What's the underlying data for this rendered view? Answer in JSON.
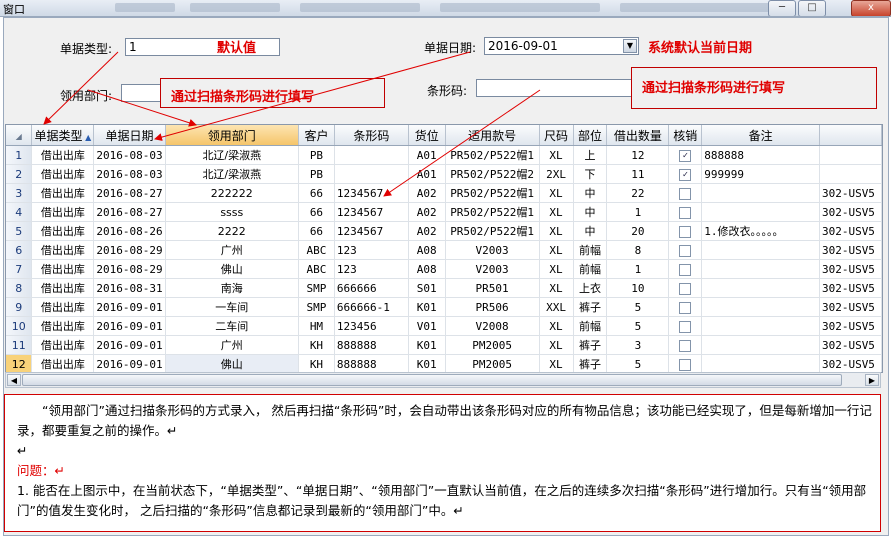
{
  "window": {
    "title": "窗口",
    "close_label": "x"
  },
  "form": {
    "doc_type_label": "单据类型:",
    "doc_type_value": "1",
    "doc_type_note": "默认值",
    "doc_date_label": "单据日期:",
    "doc_date_value": "2016-09-01",
    "doc_date_note": "系统默认当前日期",
    "dept_label": "领用部门:",
    "dept_value": "",
    "dept_note": "通过扫描条形码进行填写",
    "barcode_label": "条形码:",
    "barcode_value": "",
    "barcode_note": "通过扫描条形码进行填写"
  },
  "grid": {
    "columns": [
      "单据类型",
      "单据日期",
      "领用部门",
      "客户",
      "条形码",
      "货位",
      "适用款号",
      "尺码",
      "部位",
      "借出数量",
      "核销",
      "备注",
      ""
    ],
    "rows": [
      {
        "n": "1",
        "type": "借出出库",
        "date": "2016-08-03",
        "dept": "北辽/梁淑燕",
        "cust": "PB",
        "barcode": "",
        "loc": "A01",
        "style": "PR502/P522帽1",
        "size": "XL",
        "part": "上",
        "qty": "12",
        "checked": true,
        "remark": "888888",
        "extra": ""
      },
      {
        "n": "2",
        "type": "借出出库",
        "date": "2016-08-03",
        "dept": "北辽/梁淑燕",
        "cust": "PB",
        "barcode": "",
        "loc": "A01",
        "style": "PR502/P522帽2",
        "size": "2XL",
        "part": "下",
        "qty": "11",
        "checked": true,
        "remark": "999999",
        "extra": ""
      },
      {
        "n": "3",
        "type": "借出出库",
        "date": "2016-08-27",
        "dept": "222222",
        "cust": "66",
        "barcode": "1234567",
        "loc": "A02",
        "style": "PR502/P522帽1",
        "size": "XL",
        "part": "中",
        "qty": "22",
        "checked": false,
        "remark": "",
        "extra": "302-USV5"
      },
      {
        "n": "4",
        "type": "借出出库",
        "date": "2016-08-27",
        "dept": "ssss",
        "cust": "66",
        "barcode": "1234567",
        "loc": "A02",
        "style": "PR502/P522帽1",
        "size": "XL",
        "part": "中",
        "qty": "1",
        "checked": false,
        "remark": "",
        "extra": "302-USV5"
      },
      {
        "n": "5",
        "type": "借出出库",
        "date": "2016-08-26",
        "dept": "2222",
        "cust": "66",
        "barcode": "1234567",
        "loc": "A02",
        "style": "PR502/P522帽1",
        "size": "XL",
        "part": "中",
        "qty": "20",
        "checked": false,
        "remark": "1.修改衣。。。。。",
        "extra": "302-USV5"
      },
      {
        "n": "6",
        "type": "借出出库",
        "date": "2016-08-29",
        "dept": "广州",
        "cust": "ABC",
        "barcode": "123",
        "loc": "A08",
        "style": "V2003",
        "size": "XL",
        "part": "前幅",
        "qty": "8",
        "checked": false,
        "remark": "",
        "extra": "302-USV5"
      },
      {
        "n": "7",
        "type": "借出出库",
        "date": "2016-08-29",
        "dept": "佛山",
        "cust": "ABC",
        "barcode": "123",
        "loc": "A08",
        "style": "V2003",
        "size": "XL",
        "part": "前幅",
        "qty": "1",
        "checked": false,
        "remark": "",
        "extra": "302-USV5"
      },
      {
        "n": "8",
        "type": "借出出库",
        "date": "2016-08-31",
        "dept": "南海",
        "cust": "SMP",
        "barcode": "666666",
        "loc": "S01",
        "style": "PR501",
        "size": "XL",
        "part": "上衣",
        "qty": "10",
        "checked": false,
        "remark": "",
        "extra": "302-USV5"
      },
      {
        "n": "9",
        "type": "借出出库",
        "date": "2016-09-01",
        "dept": "一车间",
        "cust": "SMP",
        "barcode": "666666-1",
        "loc": "K01",
        "style": "PR506",
        "size": "XXL",
        "part": "裤子",
        "qty": "5",
        "checked": false,
        "remark": "",
        "extra": "302-USV5"
      },
      {
        "n": "10",
        "type": "借出出库",
        "date": "2016-09-01",
        "dept": "二车间",
        "cust": "HM",
        "barcode": "123456",
        "loc": "V01",
        "style": "V2008",
        "size": "XL",
        "part": "前幅",
        "qty": "5",
        "checked": false,
        "remark": "",
        "extra": "302-USV5"
      },
      {
        "n": "11",
        "type": "借出出库",
        "date": "2016-09-01",
        "dept": "广州",
        "cust": "KH",
        "barcode": "888888",
        "loc": "K01",
        "style": "PM2005",
        "size": "XL",
        "part": "裤子",
        "qty": "3",
        "checked": false,
        "remark": "",
        "extra": "302-USV5"
      },
      {
        "n": "12",
        "type": "借出出库",
        "date": "2016-09-01",
        "dept": "佛山",
        "cust": "KH",
        "barcode": "888888",
        "loc": "K01",
        "style": "PM2005",
        "size": "XL",
        "part": "裤子",
        "qty": "5",
        "checked": false,
        "remark": "",
        "extra": "302-USV5"
      }
    ]
  },
  "note": {
    "para1": "“领用部门”通过扫描条形码的方式录入， 然后再扫描“条形码”时，会自动带出该条形码对应的所有物品信息；该功能已经实现了，但是每新增加一行记录，都要重复之前的操作。↵",
    "blank": "↵",
    "question_title": "问题：↵",
    "question1": "1.  能否在上图示中，在当前状态下，“单据类型”、“单据日期”、“领用部门”一直默认当前值，在之后的连续多次扫描“条形码”进行增加行。只有当“领用部门”的值发生变化时， 之后扫描的“条形码”信息都记录到最新的“领用部门”中。↵"
  },
  "colors": {
    "annotation": "#e00000",
    "selected_row": "#f8d27a",
    "header_highlight": "#f5c56a"
  }
}
